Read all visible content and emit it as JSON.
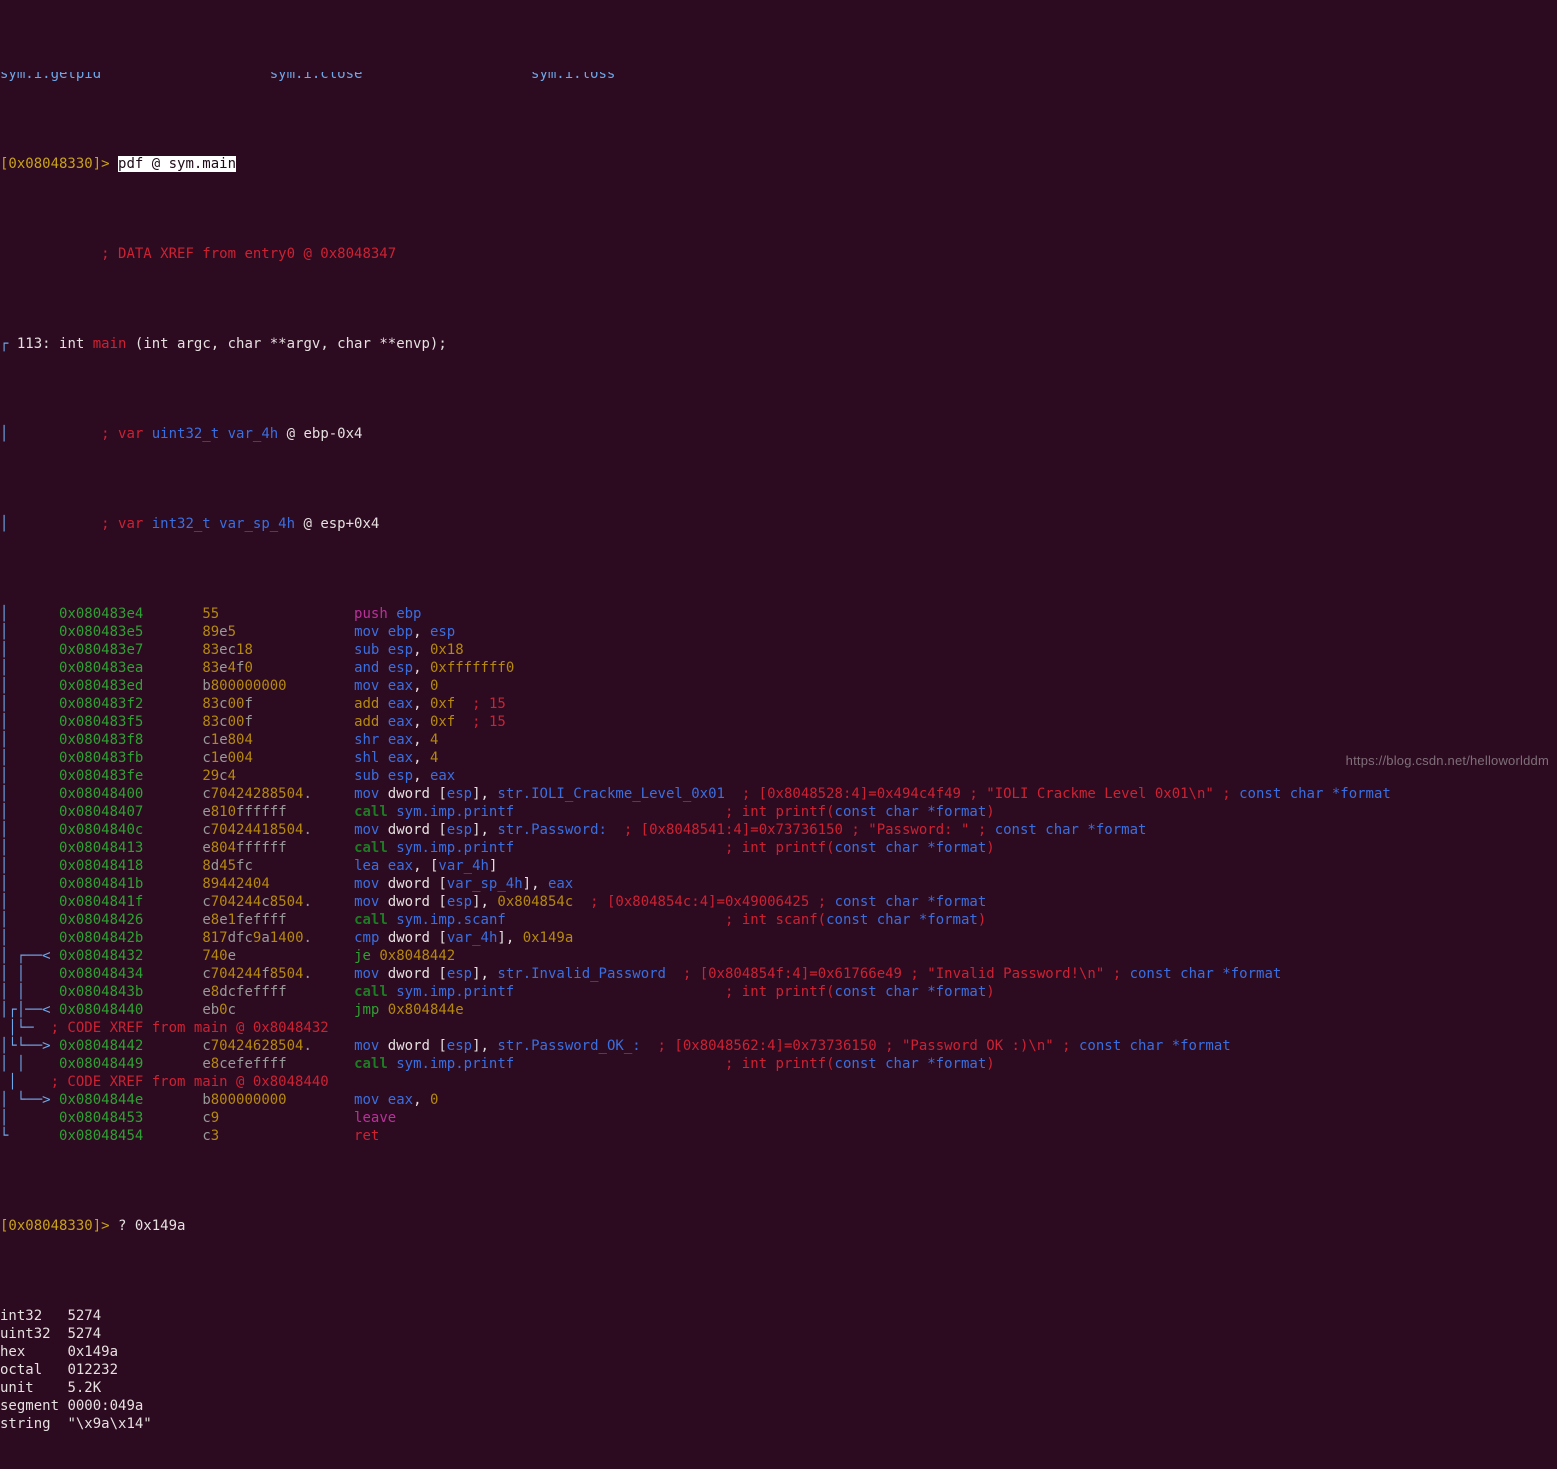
{
  "terminal": {
    "background": "#2c0a20",
    "foreground": "#d9d4d4",
    "partial_top_row": "sym.i.getpid                    sym.i.close                    sym.i.loss",
    "prompt_address": "[0x08048330]>",
    "command_1": "pdf @ sym.main",
    "prompt_address_2": "[0x08048330]>",
    "command_2": "? 0x149a"
  },
  "function_header": {
    "xref_comment": "; DATA XREF from entry0 @ 0x8048347",
    "size": "113:",
    "ret_type": "int",
    "name": "main",
    "signature": " (int argc, char **argv, char **envp);",
    "vars": [
      {
        "kw": "; var ",
        "type": "uint32_t",
        "name": " var_4h ",
        "loc": "@ ebp-0x4"
      },
      {
        "kw": "; var ",
        "type": "int32_t",
        "name": " var_sp_4h ",
        "loc": "@ esp+0x4"
      }
    ]
  },
  "disassembly": [
    {
      "offset": "0x080483e4",
      "bytes": "55",
      "mnemonic": "push",
      "operands": " ebp",
      "comment": ""
    },
    {
      "offset": "0x080483e5",
      "bytes": "89e5",
      "mnemonic": "mov",
      "operands": " ebp, esp",
      "comment": ""
    },
    {
      "offset": "0x080483e7",
      "bytes": "83ec18",
      "mnemonic": "sub",
      "operands": " esp, 0x18",
      "comment": ""
    },
    {
      "offset": "0x080483ea",
      "bytes": "83e4f0",
      "mnemonic": "and",
      "operands": " esp, 0xfffffff0",
      "comment": ""
    },
    {
      "offset": "0x080483ed",
      "bytes": "b800000000",
      "mnemonic": "mov",
      "operands": " eax, 0",
      "comment": ""
    },
    {
      "offset": "0x080483f2",
      "bytes": "83c00f",
      "mnemonic": "add",
      "operands": " eax, 0xf",
      "comment": "; 15"
    },
    {
      "offset": "0x080483f5",
      "bytes": "83c00f",
      "mnemonic": "add",
      "operands": " eax, 0xf",
      "comment": "; 15"
    },
    {
      "offset": "0x080483f8",
      "bytes": "c1e804",
      "mnemonic": "shr",
      "operands": " eax, 4",
      "comment": ""
    },
    {
      "offset": "0x080483fb",
      "bytes": "c1e004",
      "mnemonic": "shl",
      "operands": " eax, 4",
      "comment": ""
    },
    {
      "offset": "0x080483fe",
      "bytes": "29c4",
      "mnemonic": "sub",
      "operands": " esp, eax",
      "comment": ""
    },
    {
      "offset": "0x08048400",
      "bytes": "c70424288504.",
      "mnemonic": "mov",
      "operands": " dword [esp], str.IOLI_Crackme_Level_0x01",
      "comment": "; [0x8048528:4]=0x494c4f49 ; \"IOLI Crackme Level 0x01\\n\" ; const char *format"
    },
    {
      "offset": "0x08048407",
      "bytes": "e810ffffff",
      "mnemonic": "call",
      "operands": " sym.imp.printf",
      "comment": "; int printf(const char *format)"
    },
    {
      "offset": "0x0804840c",
      "bytes": "c70424418504.",
      "mnemonic": "mov",
      "operands": " dword [esp], str.Password:",
      "comment": "; [0x8048541:4]=0x73736150 ; \"Password: \" ; const char *format"
    },
    {
      "offset": "0x08048413",
      "bytes": "e804ffffff",
      "mnemonic": "call",
      "operands": " sym.imp.printf",
      "comment": "; int printf(const char *format)"
    },
    {
      "offset": "0x08048418",
      "bytes": "8d45fc",
      "mnemonic": "lea",
      "operands": " eax, [var_4h]",
      "comment": ""
    },
    {
      "offset": "0x0804841b",
      "bytes": "89442404",
      "mnemonic": "mov",
      "operands": " dword [var_sp_4h], eax",
      "comment": ""
    },
    {
      "offset": "0x0804841f",
      "bytes": "c704244c8504.",
      "mnemonic": "mov",
      "operands": " dword [esp], 0x804854c",
      "comment": "; [0x804854c:4]=0x49006425 ; const char *format"
    },
    {
      "offset": "0x08048426",
      "bytes": "e8e1feffff",
      "mnemonic": "call",
      "operands": " sym.imp.scanf",
      "comment": "; int scanf(const char *format)"
    },
    {
      "offset": "0x0804842b",
      "bytes": "817dfc9a1400.",
      "mnemonic": "cmp",
      "operands": " dword [var_4h], 0x149a",
      "comment": ""
    },
    {
      "offset": "0x08048432",
      "bytes": "740e",
      "mnemonic": "je",
      "operands": " 0x8048442",
      "comment": ""
    },
    {
      "offset": "0x08048434",
      "bytes": "c704244f8504.",
      "mnemonic": "mov",
      "operands": " dword [esp], str.Invalid_Password",
      "comment": "; [0x804854f:4]=0x61766e49 ; \"Invalid Password!\\n\" ; const char *format"
    },
    {
      "offset": "0x0804843b",
      "bytes": "e8dcfeffff",
      "mnemonic": "call",
      "operands": " sym.imp.printf",
      "comment": "; int printf(const char *format)"
    },
    {
      "offset": "0x08048440",
      "bytes": "eb0c",
      "mnemonic": "jmp",
      "operands": " 0x804844e",
      "comment": ""
    },
    {
      "offset": "0x08048442",
      "bytes": "c70424628504.",
      "mnemonic": "mov",
      "operands": " dword [esp], str.Password_OK_:",
      "comment": "; [0x8048562:4]=0x73736150 ; \"Password OK :)\\n\" ; const char *format"
    },
    {
      "offset": "0x08048449",
      "bytes": "e8cefeffff",
      "mnemonic": "call",
      "operands": " sym.imp.printf",
      "comment": "; int printf(const char *format)"
    },
    {
      "offset": "0x0804844e",
      "bytes": "b800000000",
      "mnemonic": "mov",
      "operands": " eax, 0",
      "comment": ""
    },
    {
      "offset": "0x08048453",
      "bytes": "c9",
      "mnemonic": "leave",
      "operands": "",
      "comment": ""
    },
    {
      "offset": "0x08048454",
      "bytes": "c3",
      "mnemonic": "ret",
      "operands": "",
      "comment": ""
    }
  ],
  "code_xrefs": [
    {
      "text": "; CODE XREF from main @ 0x8048432"
    },
    {
      "text": "; CODE XREF from main @ 0x8048440"
    }
  ],
  "number_output": {
    "rows": [
      {
        "label": "int32",
        "value": "5274"
      },
      {
        "label": "uint32",
        "value": "5274"
      },
      {
        "label": "hex",
        "value": "0x149a"
      },
      {
        "label": "octal",
        "value": "012232"
      },
      {
        "label": "unit",
        "value": "5.2K"
      },
      {
        "label": "segment",
        "value": "0000:049a"
      },
      {
        "label": "string",
        "value": "\"\\x9a\\x14\""
      }
    ]
  },
  "watermark": "https://blog.csdn.net/helloworlddm"
}
